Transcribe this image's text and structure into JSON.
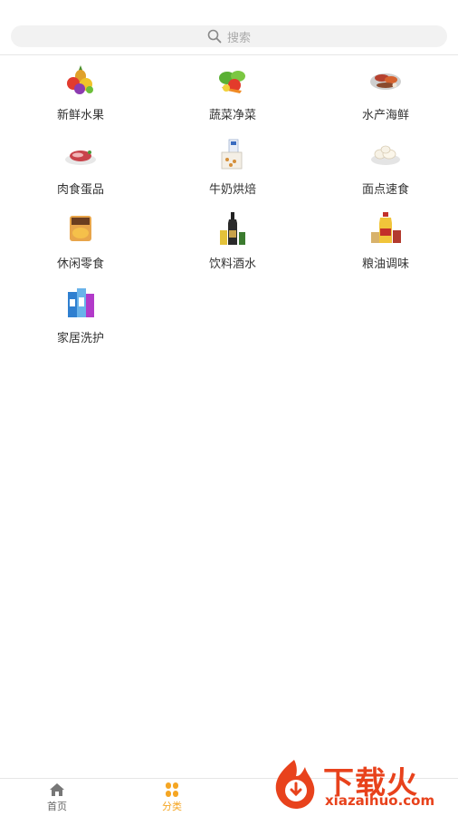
{
  "search": {
    "placeholder": "搜索",
    "icon": "search-icon"
  },
  "categories": [
    {
      "label": "新鲜水果",
      "icon": "fruit-icon"
    },
    {
      "label": "蔬菜净菜",
      "icon": "vegetable-icon"
    },
    {
      "label": "水产海鲜",
      "icon": "seafood-icon"
    },
    {
      "label": "肉食蛋品",
      "icon": "meat-icon"
    },
    {
      "label": "牛奶烘焙",
      "icon": "milk-bakery-icon"
    },
    {
      "label": "面点速食",
      "icon": "noodle-icon"
    },
    {
      "label": "休闲零食",
      "icon": "snack-icon"
    },
    {
      "label": "饮料酒水",
      "icon": "drinks-icon"
    },
    {
      "label": "粮油调味",
      "icon": "grain-oil-icon"
    },
    {
      "label": "家居洗护",
      "icon": "home-care-icon"
    }
  ],
  "tabbar": {
    "home": {
      "label": "首页",
      "icon": "home-icon"
    },
    "category": {
      "label": "分类",
      "icon": "category-icon"
    }
  },
  "watermark": {
    "title": "下载火",
    "url": "xiazaihuo.com"
  },
  "colors": {
    "accent": "#f5a623",
    "watermark": "#e8421c"
  }
}
